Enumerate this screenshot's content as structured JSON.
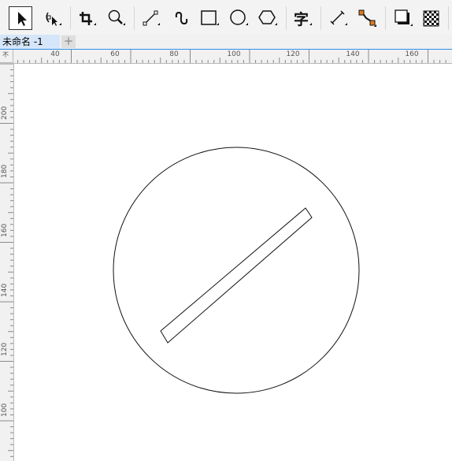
{
  "toolbar": {
    "tools": [
      {
        "name": "pick-tool",
        "icon": "arrow-pointer-icon"
      },
      {
        "name": "shape-tool",
        "icon": "node-edit-icon"
      },
      {
        "name": "crop-tool",
        "icon": "crop-icon"
      },
      {
        "name": "zoom-tool",
        "icon": "magnifier-icon"
      },
      {
        "name": "freehand-tool",
        "icon": "line-icon"
      },
      {
        "name": "artistic-media-tool",
        "icon": "curve-icon"
      },
      {
        "name": "rectangle-tool",
        "icon": "rectangle-icon"
      },
      {
        "name": "ellipse-tool",
        "icon": "ellipse-icon"
      },
      {
        "name": "polygon-tool",
        "icon": "polygon-icon"
      },
      {
        "name": "text-tool",
        "icon": "text-icon",
        "glyph": "字"
      },
      {
        "name": "dimension-tool",
        "icon": "dimension-icon"
      },
      {
        "name": "connector-tool",
        "icon": "connector-icon"
      },
      {
        "name": "drop-shadow-tool",
        "icon": "shadow-icon"
      },
      {
        "name": "transparency-tool",
        "icon": "checker-icon"
      }
    ]
  },
  "tabs": {
    "active_label": "未命名 -1",
    "add_symbol": "+"
  },
  "rulers": {
    "horizontal_labels": [
      "40",
      "60",
      "80",
      "100",
      "120",
      "140",
      "160"
    ],
    "vertical_labels": [
      "200",
      "180",
      "160",
      "140",
      "120",
      "100"
    ],
    "units_symbol": "不"
  },
  "colors": {
    "accent": "#2f8fe4",
    "connector_orange": "#e07a1f",
    "shape_stroke": "#111111"
  }
}
